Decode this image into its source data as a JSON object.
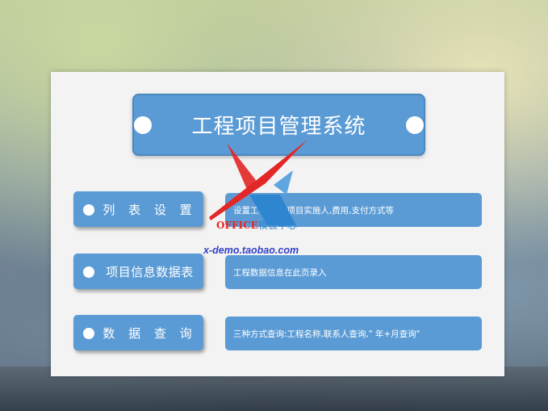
{
  "title": "工程项目管理系统",
  "menu": [
    {
      "label": "列 表 设 置",
      "description": "设置工程类别,项目实施人,费用,支付方式等"
    },
    {
      "label": "项目信息数据表",
      "description": "工程数据信息在此页录入"
    },
    {
      "label": "数 据 查 询",
      "description": "三种方式查询:工程名称,联系人查询,\" 年+月查询\""
    }
  ],
  "watermark": {
    "brand": "OFFICE",
    "brand_cn": "模板中心",
    "url": "x-demo.taobao.com"
  },
  "colors": {
    "accent": "#5b9bd5",
    "panel": "#f3f3f3",
    "logo_red": "#e32626",
    "logo_blue": "#2f86d0"
  }
}
